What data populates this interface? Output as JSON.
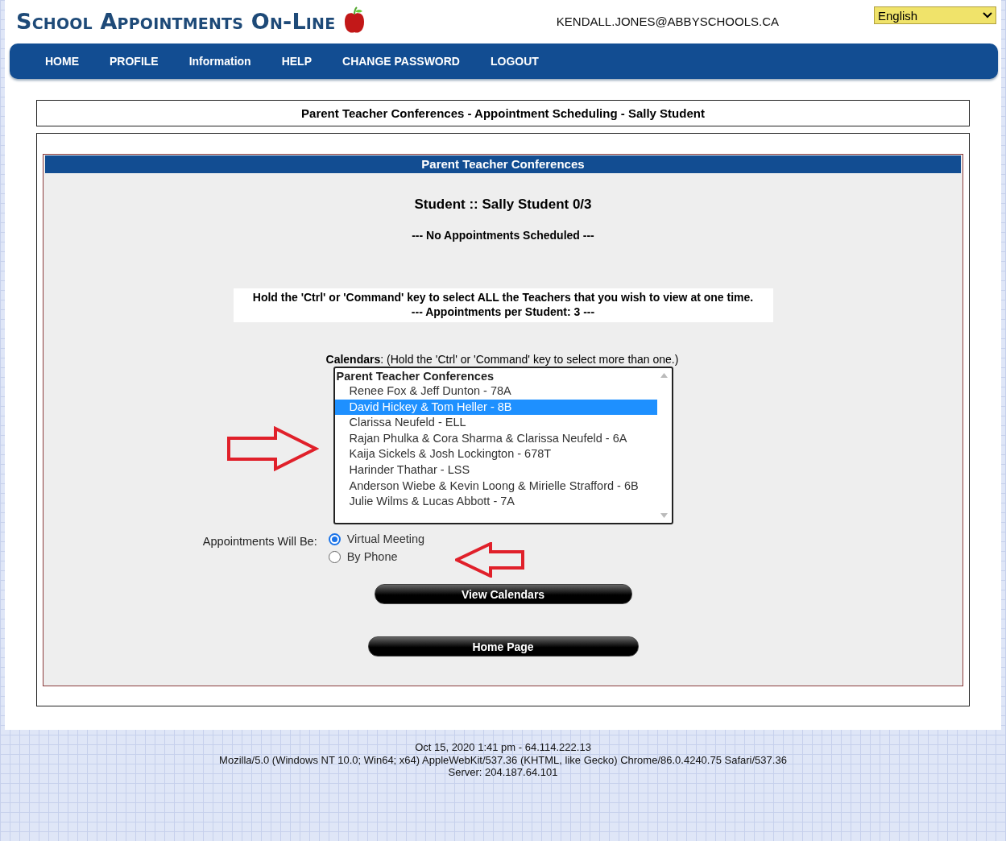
{
  "header": {
    "logo": "School Appointments On-Line",
    "email": "KENDALL.JONES@ABBYSCHOOLS.CA",
    "language": "English"
  },
  "nav": [
    "HOME",
    "PROFILE",
    "Information",
    "HELP",
    "CHANGE PASSWORD",
    "LOGOUT"
  ],
  "page_title": "Parent Teacher Conferences - Appointment Scheduling - Sally Student",
  "panel": {
    "title": "Parent Teacher Conferences",
    "student": "Student :: Sally Student 0/3",
    "status": "--- No Appointments Scheduled ---",
    "notice": [
      "Hold the 'Ctrl' or 'Command' key to select ALL the Teachers that you wish to view at one time.",
      "--- Appointments per Student: 3 ---"
    ],
    "calendars_label": "**Calendars**: (Hold the 'Ctrl' or 'Command' key to select more than one.)",
    "calendar_group": "Parent Teacher Conferences",
    "calendars": [
      {
        "label": "Renee Fox & Jeff Dunton - 78A",
        "selected": false
      },
      {
        "label": "David Hickey & Tom Heller - 8B",
        "selected": true
      },
      {
        "label": "Clarissa Neufeld - ELL",
        "selected": false
      },
      {
        "label": "Rajan Phulka & Cora Sharma & Clarissa Neufeld - 6A",
        "selected": false
      },
      {
        "label": "Kaija Sickels & Josh Lockington - 678T",
        "selected": false
      },
      {
        "label": "Harinder Thathar - LSS",
        "selected": false
      },
      {
        "label": "Anderson Wiebe & Kevin Loong & Mirielle Strafford - 6B",
        "selected": false
      },
      {
        "label": "Julie Wilms & Lucas Abbott - 7A",
        "selected": false
      }
    ],
    "mode_label": "Appointments Will Be:",
    "modes": [
      {
        "label": "Virtual Meeting",
        "selected": true
      },
      {
        "label": "By Phone",
        "selected": false
      }
    ],
    "buttons": [
      "View Calendars",
      "Home Page"
    ]
  },
  "footer": [
    "Oct 15, 2020 1:41 pm - 64.114.222.13",
    "Mozilla/5.0 (Windows NT 10.0; Win64; x64) AppleWebKit/537.36 (KHTML, like Gecko) Chrome/86.0.4240.75 Safari/537.36",
    "Server: 204.187.64.101"
  ]
}
